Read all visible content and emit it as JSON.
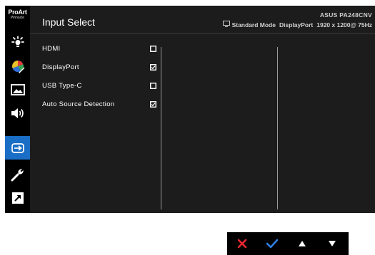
{
  "brand": {
    "logo_line1": "ProArt",
    "logo_line2": "Pinnacle"
  },
  "header": {
    "title": "Input Select",
    "model": "ASUS PA248CNV",
    "mode": "Standard Mode",
    "input": "DisplayPort",
    "resolution": "1920 x 1200@ 75Hz"
  },
  "sidebar": {
    "items": [
      {
        "icon": "brightness-icon",
        "active": false
      },
      {
        "icon": "color-icon",
        "active": false
      },
      {
        "icon": "image-icon",
        "active": false
      },
      {
        "icon": "sound-icon",
        "active": false
      },
      {
        "icon": "input-select-icon",
        "active": true
      },
      {
        "icon": "system-setup-icon",
        "active": false
      },
      {
        "icon": "shortcut-icon",
        "active": false
      }
    ]
  },
  "options": [
    {
      "label": "HDMI",
      "checked": false
    },
    {
      "label": "DisplayPort",
      "checked": true
    },
    {
      "label": "USB Type-C",
      "checked": false
    },
    {
      "label": "Auto Source Detection",
      "checked": true
    }
  ],
  "controls": [
    "close-icon",
    "check-icon",
    "arrow-up-icon",
    "arrow-down-icon"
  ],
  "colors": {
    "active_bg": "#1a6ec5",
    "close_red": "#e8262f",
    "confirm_blue": "#2f7fe0",
    "panel_bg": "#1c1c1c"
  }
}
